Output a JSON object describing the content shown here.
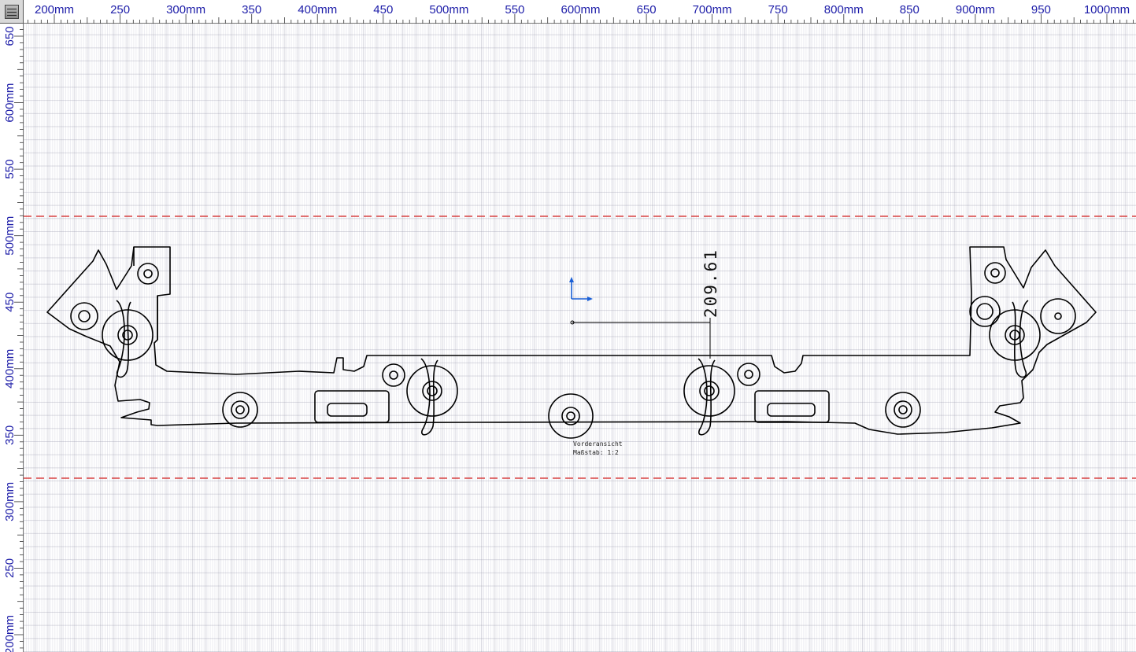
{
  "ruler_top": {
    "labels": [
      "200mm",
      "250",
      "300mm",
      "350",
      "400mm",
      "450",
      "500mm",
      "550",
      "600mm",
      "650",
      "700mm",
      "750",
      "800mm",
      "850",
      "900mm",
      "950",
      "1000mm"
    ]
  },
  "ruler_left": {
    "labels": [
      "650",
      "600mm",
      "550",
      "500mm",
      "450",
      "400mm",
      "350",
      "300mm",
      "250",
      "200mm"
    ]
  },
  "drawing": {
    "dimension_value": "209.61",
    "view_name": "Vorderansicht",
    "scale": "Maßstab:  1:2"
  },
  "colors": {
    "ruler_text": "#1c1ca8",
    "guide_line": "#d21e1e",
    "axis_marker": "#1a5fd6",
    "outline": "#000000"
  },
  "icons": [
    "menu-icon"
  ]
}
